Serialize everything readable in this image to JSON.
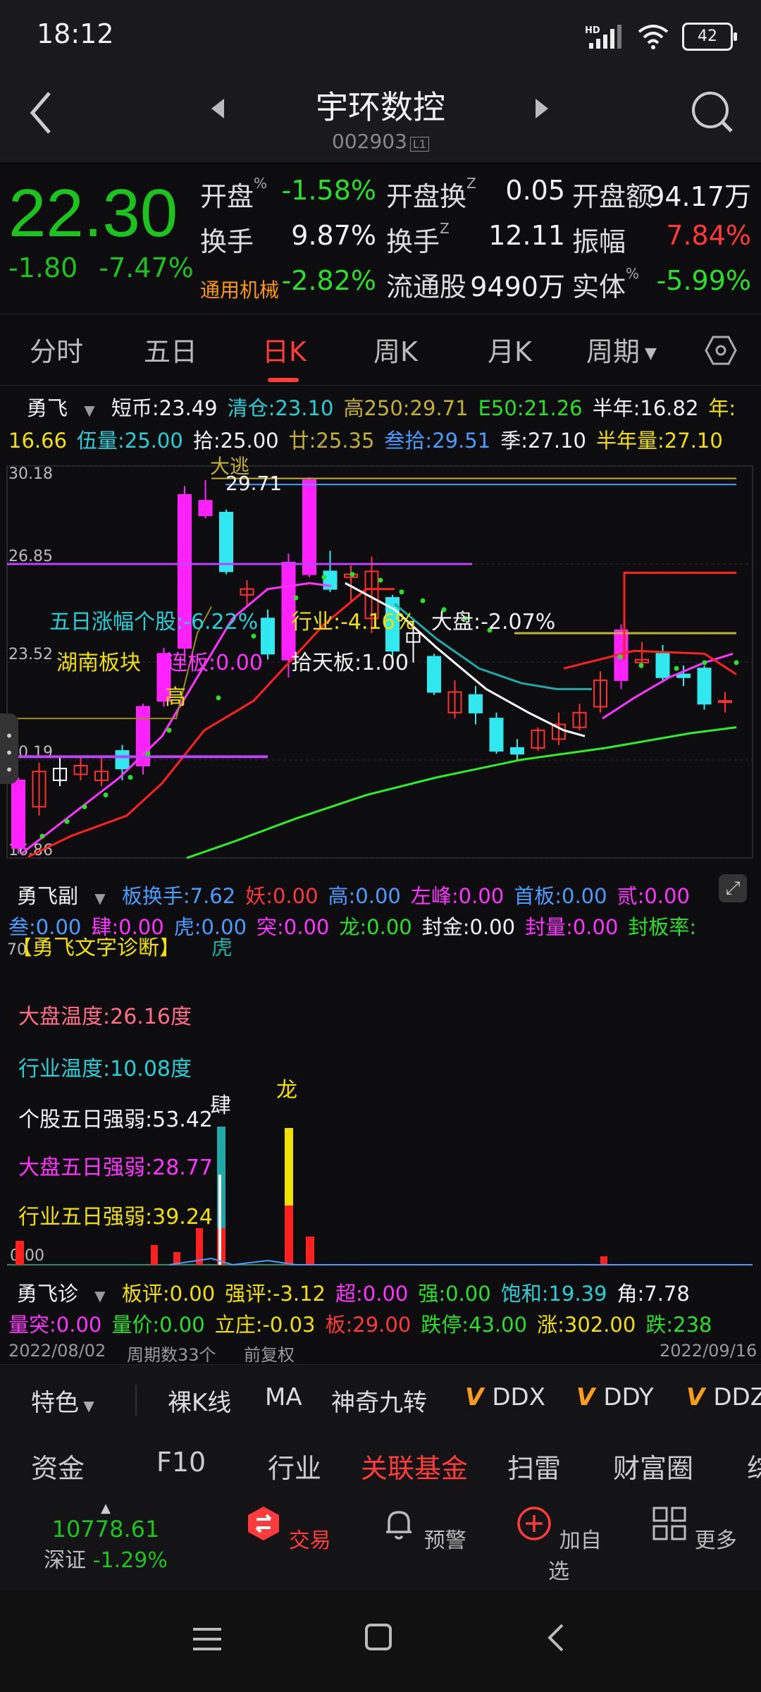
{
  "status": {
    "time": "18:12",
    "battery": "42",
    "net": "HD"
  },
  "header": {
    "title": "宇环数控",
    "code": "002903",
    "code_tag": "L1"
  },
  "quote": {
    "price": "22.30",
    "change": "-1.80",
    "change_pct": "-7.47%",
    "rows": [
      [
        {
          "label": "开盘",
          "sup": "%",
          "value": "-1.58%",
          "vc": "g"
        },
        {
          "label": "开盘换",
          "sup": "Z",
          "value": "0.05",
          "vc": "w"
        },
        {
          "label": "开盘额",
          "value": "94.17万",
          "vc": "w"
        }
      ],
      [
        {
          "label": "换手",
          "value": "9.87%",
          "vc": "w"
        },
        {
          "label": "换手",
          "sup": "Z",
          "value": "12.11",
          "vc": "w"
        },
        {
          "label": "振幅",
          "value": "7.84%",
          "vc": "r"
        }
      ],
      [
        {
          "label": "通用机械",
          "value": "-2.82%",
          "vc": "g",
          "lc": "o"
        },
        {
          "label": "流通股",
          "value": "9490万",
          "vc": "w"
        },
        {
          "label": "实体",
          "sup": "%",
          "value": "-5.99%",
          "vc": "g"
        }
      ]
    ]
  },
  "tabs": [
    "分时",
    "五日",
    "日K",
    "周K",
    "月K",
    "周期"
  ],
  "main_legend": {
    "name": "勇飞",
    "line1": [
      [
        "短币:",
        "23.49",
        "w"
      ],
      [
        "清仓:",
        "23.10",
        "cy"
      ],
      [
        "高250:",
        "29.71",
        "olive"
      ],
      [
        "E50:",
        "21.26",
        "g"
      ],
      [
        "半年:",
        "16.82",
        "w"
      ],
      [
        "年:",
        "",
        "y"
      ]
    ],
    "line2": [
      [
        "",
        "16.66",
        "y"
      ],
      [
        "伍量:",
        "25.00",
        "cy"
      ],
      [
        "拾:",
        "25.00",
        "w"
      ],
      [
        "廿:",
        "25.35",
        "olive"
      ],
      [
        "叁拾:",
        "29.51",
        "b"
      ],
      [
        "季:",
        "27.10",
        "w"
      ],
      [
        "半年量:",
        "27.10",
        "y"
      ]
    ]
  },
  "kchart": {
    "y_labels": [
      "30.18",
      "26.85",
      "23.52",
      "20.19",
      "16.86"
    ],
    "annotations": {
      "dazhao": "大逃",
      "high_val": "29.71",
      "wuri": "五日涨幅个股:-6.22%",
      "hangye": "行业:-4.16%",
      "dapan": "大盘:-2.07%",
      "hunan": "湖南板块",
      "lianban": "连板:0.00",
      "shitian": "拾天板:1.00",
      "gao": "高"
    }
  },
  "sub_legend": {
    "name": "勇飞副",
    "line1": [
      [
        "板换手:",
        "7.62",
        "b"
      ],
      [
        "妖:",
        "0.00",
        "r"
      ],
      [
        "高:",
        "0.00",
        "b"
      ],
      [
        "左峰:",
        "0.00",
        "m"
      ],
      [
        "首板:",
        "0.00",
        "b"
      ],
      [
        "贰:",
        "0.00",
        "m"
      ]
    ],
    "line2": [
      [
        "叁:",
        "0.00",
        "b"
      ],
      [
        "肆:",
        "0.00",
        "m"
      ],
      [
        "虎:",
        "0.00",
        "b"
      ],
      [
        "突:",
        "0.00",
        "m"
      ],
      [
        "龙:",
        "0.00",
        "g"
      ],
      [
        "封金:",
        "0.00",
        "w"
      ],
      [
        "封量:",
        "0.00",
        "m"
      ],
      [
        "封板率:",
        "",
        "g"
      ]
    ]
  },
  "subchart": {
    "ytop": "70",
    "ybottom": "0.00",
    "title": "【勇飞文字诊断】",
    "tiger": "虎",
    "diag": [
      [
        "大盘温度:26.16度",
        "pink"
      ],
      [
        "行业温度:10.08度",
        "cy"
      ],
      [
        "个股五日强弱:53.42",
        "w"
      ],
      [
        "大盘五日强弱:28.77",
        "m"
      ],
      [
        "行业五日强弱:39.24",
        "y"
      ]
    ],
    "si": "肆",
    "long": "龙"
  },
  "third_legend": {
    "name": "勇飞诊",
    "line1": [
      [
        "板评:",
        "0.00",
        "y"
      ],
      [
        "强评:",
        "-3.12",
        "y"
      ],
      [
        "超:",
        "0.00",
        "m"
      ],
      [
        "强:",
        "0.00",
        "g"
      ],
      [
        "饱和:",
        "19.39",
        "cy"
      ],
      [
        "角:",
        "7.78",
        "w"
      ]
    ],
    "line2": [
      [
        "量突:",
        "0.00",
        "m"
      ],
      [
        "量价:",
        "0.00",
        "g"
      ],
      [
        "立庄:",
        "-0.03",
        "y"
      ],
      [
        "板:",
        "29.00",
        "r"
      ],
      [
        "跌停:",
        "43.00",
        "g"
      ],
      [
        "涨:",
        "302.00",
        "y"
      ],
      [
        "跌:",
        "238",
        "g"
      ]
    ]
  },
  "date_bar": {
    "start": "2022/08/02",
    "weeks": "周期数33个",
    "fq": "前复权",
    "end": "2022/09/16"
  },
  "toolbar": {
    "special": "特色",
    "items": [
      "裸K线",
      "MA",
      "神奇九转"
    ],
    "v_items": [
      "DDX",
      "DDY",
      "DDZ"
    ]
  },
  "funcbar": [
    "资金",
    "F10",
    "行业",
    "关联基金",
    "扫雷",
    "财富圈",
    "综"
  ],
  "navbar": {
    "index_val": "10778.61",
    "index_name": "深证",
    "index_chg": "-1.29%",
    "items": [
      "交易",
      "预警",
      "加自选",
      "更多"
    ]
  },
  "colors": {
    "down": "#1bc41b",
    "up": "#ff3838",
    "accent": "#ff3b3b"
  }
}
